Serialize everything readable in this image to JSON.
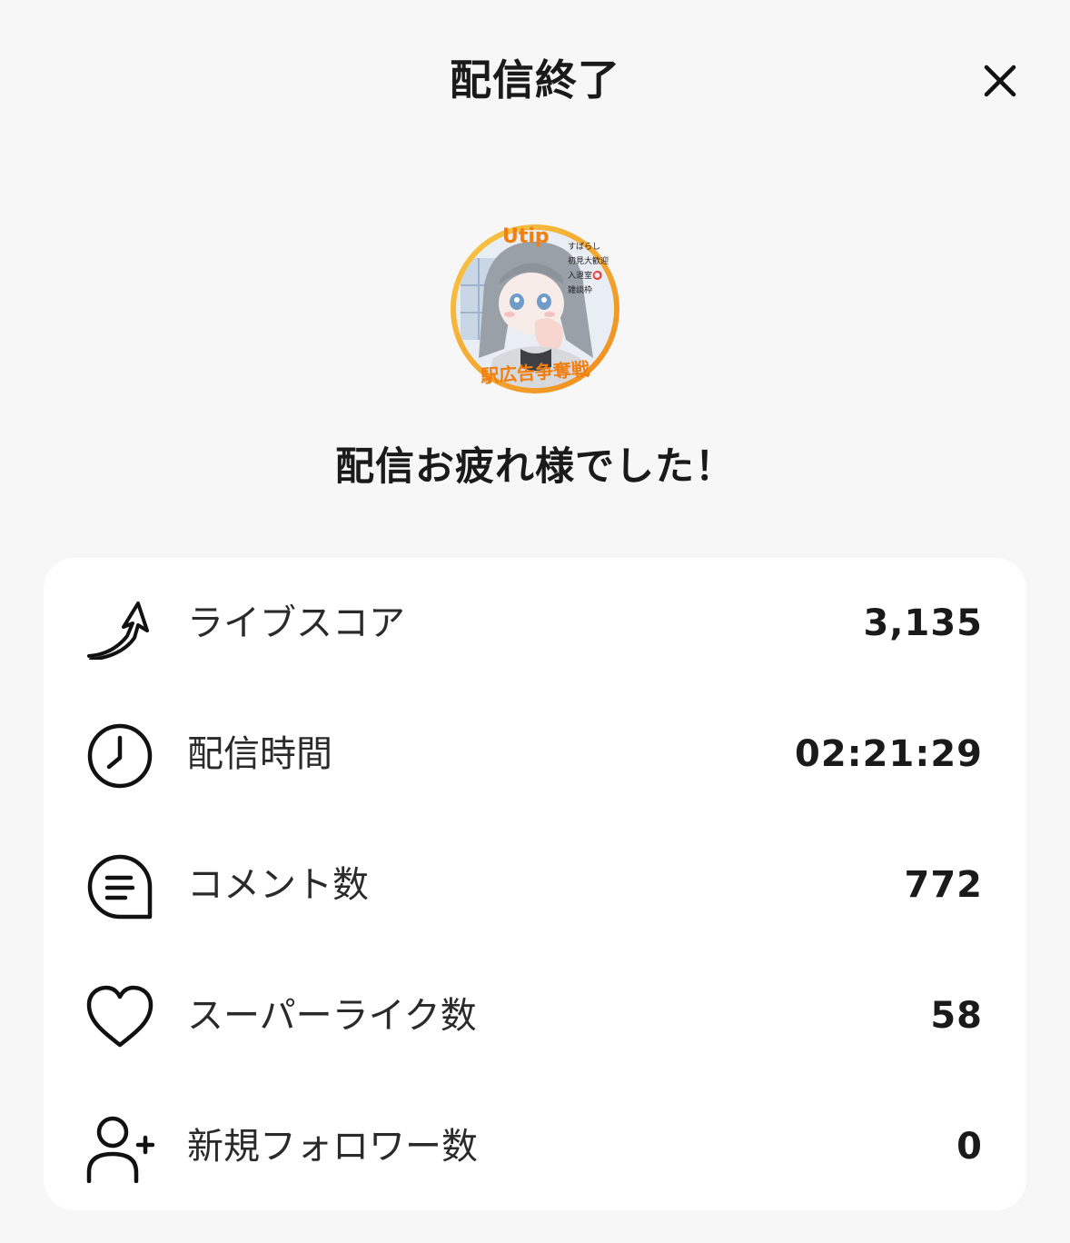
{
  "header": {
    "title": "配信終了",
    "close_icon": "close-icon"
  },
  "avatar": {
    "badge_text": "Utip",
    "notes": "すばらし\n初見大歓迎\n入退室⭕\n雑談枠",
    "banner_text": "駅広告争奪戦",
    "ring_colors": [
      "#f7c948",
      "#f08a1c"
    ]
  },
  "message": "配信お疲れ様でした！",
  "stats": [
    {
      "icon": "live-score-arrow-icon",
      "label": "ライブスコア",
      "value": "3,135"
    },
    {
      "icon": "clock-icon",
      "label": "配信時間",
      "value": "02:21:29"
    },
    {
      "icon": "comment-icon",
      "label": "コメント数",
      "value": "772"
    },
    {
      "icon": "heart-icon",
      "label": "スーパーライク数",
      "value": "58"
    },
    {
      "icon": "add-user-icon",
      "label": "新規フォロワー数",
      "value": "0"
    }
  ]
}
